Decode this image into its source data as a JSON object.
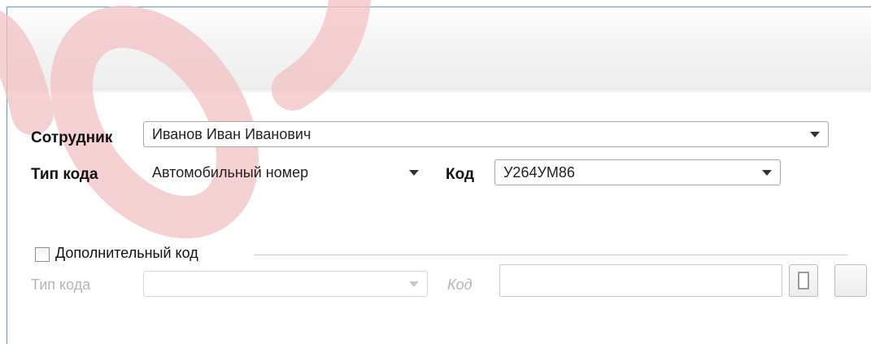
{
  "form": {
    "employee": {
      "label": "Сотрудник",
      "value": "Иванов Иван Иванович"
    },
    "code_type": {
      "label": "Тип кода",
      "value": "Автомобильный номер"
    },
    "code": {
      "label": "Код",
      "value": "У264УМ86"
    },
    "extra_code": {
      "checkbox_label": "Дополнительный код",
      "checked": false,
      "code_type_label": "Тип кода",
      "code_type_value": "",
      "code_label": "Код",
      "code_value": ""
    }
  },
  "colors": {
    "frame_border": "#4aa3c8",
    "watermark": "#f2b6b6",
    "disabled_text": "#b5b5b5"
  },
  "icons": [
    "document-icon",
    "dropdown-arrow-icon"
  ]
}
